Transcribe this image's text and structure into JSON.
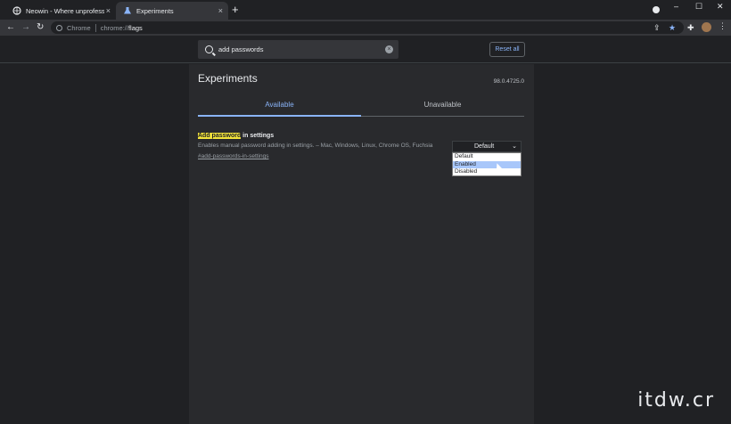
{
  "tabs": [
    {
      "title": "Neowin - Where unprofessional",
      "close": "×"
    },
    {
      "title": "Experiments",
      "close": "×"
    }
  ],
  "new_tab": "+",
  "window_controls": {
    "minimize": "–",
    "maximize": "☐",
    "close": "✕"
  },
  "toolbar": {
    "back": "←",
    "forward": "→",
    "reload": "↻",
    "site_label": "Chrome",
    "url_scheme": "chrome://",
    "url_path": "flags",
    "kebab": "⋮"
  },
  "search": {
    "value": "add passwords",
    "clear": "×"
  },
  "reset_label": "Reset all",
  "page": {
    "title": "Experiments",
    "version": "98.0.4725.0",
    "tab_available": "Available",
    "tab_unavailable": "Unavailable"
  },
  "flag": {
    "name_highlight": "Add password",
    "name_rest": " in settings",
    "description": "Enables manual password adding in settings. – Mac, Windows, Linux, Chrome OS, Fuchsia",
    "link": "#add-passwords-in-settings",
    "selected": "Default",
    "options": [
      "Default",
      "Enabled",
      "Disabled"
    ],
    "highlighted_option": "Enabled"
  },
  "watermark": "itdw.cr",
  "colors": {
    "accent": "#8ab4f8",
    "highlight": "#f2e33b",
    "bg": "#202124",
    "panel": "#292a2d"
  }
}
